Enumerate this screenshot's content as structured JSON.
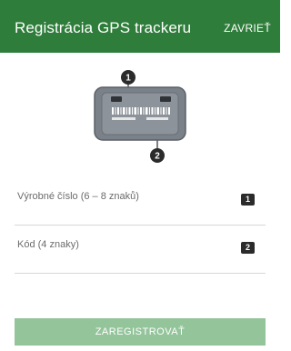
{
  "header": {
    "title": "Registrácia GPS trackeru",
    "close_label": "ZAVRIEŤ"
  },
  "illustration": {
    "marker_1": "1",
    "marker_2": "2"
  },
  "form": {
    "serial": {
      "placeholder": "Výrobné číslo (6 – 8 znaků)",
      "badge": "1"
    },
    "code": {
      "placeholder": "Kód (4 znaky)",
      "badge": "2"
    }
  },
  "register_label": "ZAREGISTROVAŤ",
  "colors": {
    "header": "#2e7d3a",
    "button_disabled": "#93c49a",
    "badge": "#2b2b2b"
  }
}
